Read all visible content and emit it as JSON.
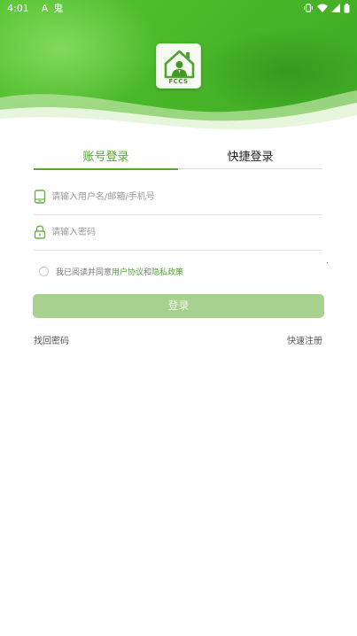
{
  "status_bar": {
    "time": "4:01",
    "sim_icon": "A",
    "app_glyph": "鬼",
    "icons": [
      "vibrate-icon",
      "wifi-icon",
      "signal-icon",
      "battery-icon"
    ]
  },
  "brand": {
    "logo_text": "FCCS",
    "primary_color": "#56a831",
    "button_color": "#a8d08f"
  },
  "tabs": [
    {
      "label": "账号登录",
      "active": true
    },
    {
      "label": "快捷登录",
      "active": false
    }
  ],
  "fields": {
    "username": {
      "placeholder": "请输入用户名/邮箱/手机号",
      "value": ""
    },
    "password": {
      "placeholder": "请输入密码",
      "value": ""
    }
  },
  "agreement": {
    "prefix": "我已阅读并同意",
    "user_agreement": "用户协议",
    "and": "和",
    "privacy_policy": "隐私政策",
    "checked": false
  },
  "login_button": "登录",
  "links": {
    "forgot_password": "找回密码",
    "register": "快速注册"
  }
}
